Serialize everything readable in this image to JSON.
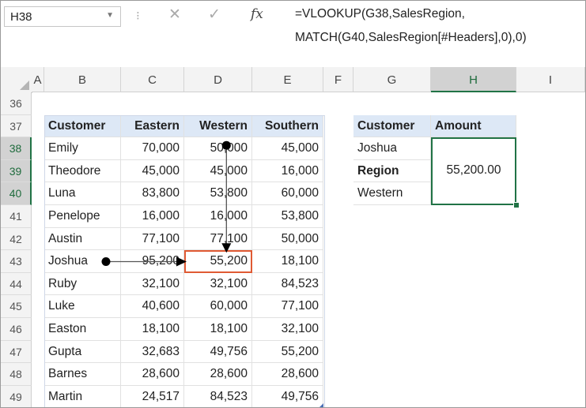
{
  "formula_bar": {
    "name_box": "H38",
    "fx_label": "fx",
    "formula_lines": [
      "=VLOOKUP(G38,SalesRegion,",
      "MATCH(G40,SalesRegion[#Headers],0),0)"
    ]
  },
  "columns": [
    "A",
    "B",
    "C",
    "D",
    "E",
    "F",
    "G",
    "H",
    "I"
  ],
  "rows": [
    "36",
    "37",
    "38",
    "39",
    "40",
    "41",
    "42",
    "43",
    "44",
    "45",
    "46",
    "47",
    "48",
    "49"
  ],
  "sales_table": {
    "headers": [
      "Customer",
      "Eastern",
      "Western",
      "Southern"
    ],
    "rows": [
      [
        "Emily",
        "70,000",
        "50,000",
        "45,000"
      ],
      [
        "Theodore",
        "45,000",
        "45,000",
        "16,000"
      ],
      [
        "Luna",
        "83,800",
        "53,800",
        "60,000"
      ],
      [
        "Penelope",
        "16,000",
        "16,000",
        "53,800"
      ],
      [
        "Austin",
        "77,100",
        "77,100",
        "50,000"
      ],
      [
        "Joshua",
        "95,200",
        "55,200",
        "18,100"
      ],
      [
        "Ruby",
        "32,100",
        "32,100",
        "84,523"
      ],
      [
        "Luke",
        "40,600",
        "60,000",
        "77,100"
      ],
      [
        "Easton",
        "18,100",
        "18,100",
        "32,100"
      ],
      [
        "Gupta",
        "32,683",
        "49,756",
        "55,200"
      ],
      [
        "Barnes",
        "28,600",
        "28,600",
        "28,600"
      ],
      [
        "Martin",
        "24,517",
        "84,523",
        "49,756"
      ]
    ]
  },
  "lookup": {
    "header_customer": "Customer",
    "header_amount": "Amount",
    "customer_value": "Joshua",
    "region_label": "Region",
    "region_value": "Western",
    "result": "55,200.00"
  },
  "colors": {
    "table_header_fill": "#dde8f6",
    "selection": "#217346",
    "highlight": "#e05a33"
  }
}
